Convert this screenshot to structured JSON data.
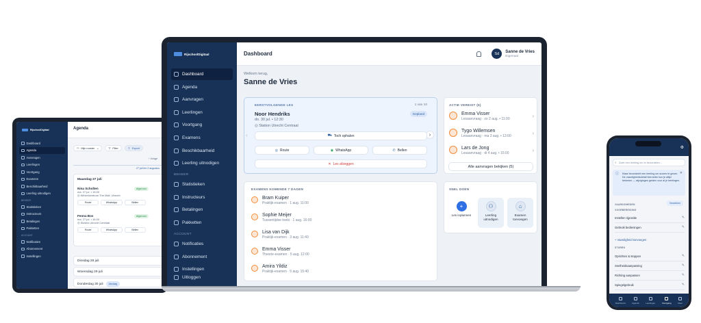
{
  "laptop": {
    "brand": "RijschoolDigitaal",
    "nav": [
      {
        "label": "Dashboard",
        "icon": "home-icon",
        "active": true
      },
      {
        "label": "Agenda",
        "icon": "calendar-icon"
      },
      {
        "label": "Aanvragen",
        "icon": "inbox-icon"
      },
      {
        "label": "Leerlingen",
        "icon": "users-icon"
      },
      {
        "label": "Voortgang",
        "icon": "bar-chart-icon"
      },
      {
        "label": "Examens",
        "icon": "graduation-cap-icon"
      },
      {
        "label": "Beschikbaarheid",
        "icon": "clock-icon"
      },
      {
        "label": "Leerling uitnodigen",
        "icon": "user-plus-icon"
      }
    ],
    "section_beheer": "BEHEER",
    "nav_beheer": [
      {
        "label": "Statistieken",
        "icon": "trend-icon"
      },
      {
        "label": "Instructeurs",
        "icon": "instructors-icon"
      },
      {
        "label": "Betalingen",
        "icon": "credit-card-icon"
      },
      {
        "label": "Pakketten",
        "icon": "package-icon"
      }
    ],
    "section_account": "ACCOUNT",
    "nav_account": [
      {
        "label": "Notificaties",
        "icon": "bell-icon"
      },
      {
        "label": "Abonnement",
        "icon": "card-icon"
      },
      {
        "label": "Instellingen",
        "icon": "gear-icon"
      }
    ],
    "logout": "Uitloggen",
    "page_title": "Dashboard",
    "user": {
      "initials": "Sd",
      "name": "Sanne de Vries",
      "role": "Eigenaar"
    },
    "welcome": "Welkom terug,",
    "welcome_name": "Sanne de Vries",
    "next_lesson": {
      "caption": "EERSTVOLGENDE LES",
      "counter": "1 van 10",
      "student": "Noor Hendriks",
      "time": "do. 30 jul. • 12:30",
      "location": "Station Utrecht Centraal",
      "status": "Gepland",
      "pickup": "Toch ophalen",
      "route": "Route",
      "whatsapp": "WhatsApp",
      "call": "Bellen",
      "cancel": "Les afzeggen"
    },
    "action": {
      "caption": "ACTIE VEREIST (5)",
      "items": [
        {
          "name": "Emma Visser",
          "sub": "Lesaanvraag · zo 2 aug. • 11:00"
        },
        {
          "name": "Tygo Willemsen",
          "sub": "Lesaanvraag · ma 3 aug. • 13:00"
        },
        {
          "name": "Lars de Jong",
          "sub": "Lesaanvraag · di 4 aug. • 15:00"
        }
      ],
      "all": "Alle aanvragen bekijken (5)"
    },
    "exams": {
      "caption": "EXAMENS KOMENDE 7 DAGEN",
      "items": [
        {
          "name": "Bram Kuiper",
          "sub": "Praktijk-examen · 1 aug. 11:00"
        },
        {
          "name": "Sophie Meijer",
          "sub": "Tussentijdse toets · 1 aug. 16:00"
        },
        {
          "name": "Lisa van Dijk",
          "sub": "Praktijk-examen · 3 aug. 11:40"
        },
        {
          "name": "Emma Visser",
          "sub": "Theorie-examen · 5 aug. 12:00"
        },
        {
          "name": "Amira Yildiz",
          "sub": "Praktijk-examen · 5 aug. 15:40"
        }
      ]
    },
    "quick": {
      "caption": "SNEL DOEN",
      "items": [
        {
          "label": "Les inplannen"
        },
        {
          "label": "Leerling uitnodigen"
        },
        {
          "label": "Examen toevoegen"
        }
      ]
    }
  },
  "tablet": {
    "brand": "RijschoolDigitaal",
    "nav": [
      {
        "label": "Dashboard"
      },
      {
        "label": "Agenda",
        "active": true
      },
      {
        "label": "Aanvragen"
      },
      {
        "label": "Leerlingen"
      },
      {
        "label": "Voortgang"
      },
      {
        "label": "Examens"
      },
      {
        "label": "Beschikbaarheid"
      },
      {
        "label": "Leerling uitnodigen"
      }
    ],
    "section_beheer": "BEHEER",
    "nav_beheer": [
      {
        "label": "Statistieken"
      },
      {
        "label": "Instructeurs"
      },
      {
        "label": "Betalingen"
      },
      {
        "label": "Pakketten"
      }
    ],
    "section_account": "ACCOUNT",
    "nav_account": [
      {
        "label": "Notificaties"
      },
      {
        "label": "Abonnement"
      },
      {
        "label": "Instellingen"
      }
    ],
    "page_title": "Agenda",
    "my_schedule": "Mijn rooster",
    "filter": "Filter",
    "export": "Export",
    "week": "Vorige",
    "range": "27 juli t/m 2 augustus",
    "day1": "Maandag 27 juli",
    "lesson1": {
      "name": "Nina Scholten",
      "time": "ma. 27 jul. • 15:00",
      "loc": "Winkelcentrum The Mall, Utrecht",
      "status": "Afgerond"
    },
    "lesson2": {
      "name": "Fenna Bos",
      "time": "ma. 27 jul. • 16:00",
      "loc": "Station Utrecht Centraal",
      "status": "Afgerond"
    },
    "btn_route": "Route",
    "btn_whatsapp": "WhatsApp",
    "btn_call": "Bellen",
    "day2": "Dinsdag 28 juli",
    "day3": "Woensdag 29 juli",
    "day4": "Donderdag 30 juli",
    "today": "Vandaag"
  },
  "phone": {
    "search_placeholder": "Zoek een leerling om te beoordelen...",
    "info": "Klaar beoordeelt een leerling om scores te geven. De vaardigheidsdetail hierneder kun je altijd bekenen — wijzigingen gelden voor al je leerlingen.",
    "sec_basics": "VAARDIGHEDEN",
    "manage": "Verwerken",
    "sec_voorbereiding": "VOORBEREIDING",
    "rows1": [
      "Instellen rijpositie",
      "Gebruik bedieningen"
    ],
    "add": "Vaardigheid toevoegen",
    "sec_sturen": "STUREN",
    "rows2": [
      "Oprichten & stoppen",
      "Snelheidsaanpassing",
      "Richting aanpassen",
      "Spiegelgebruik"
    ],
    "tabs": [
      "Dashboard",
      "Agenda",
      "Leerlingen",
      "Voortgang",
      "Meer"
    ]
  }
}
